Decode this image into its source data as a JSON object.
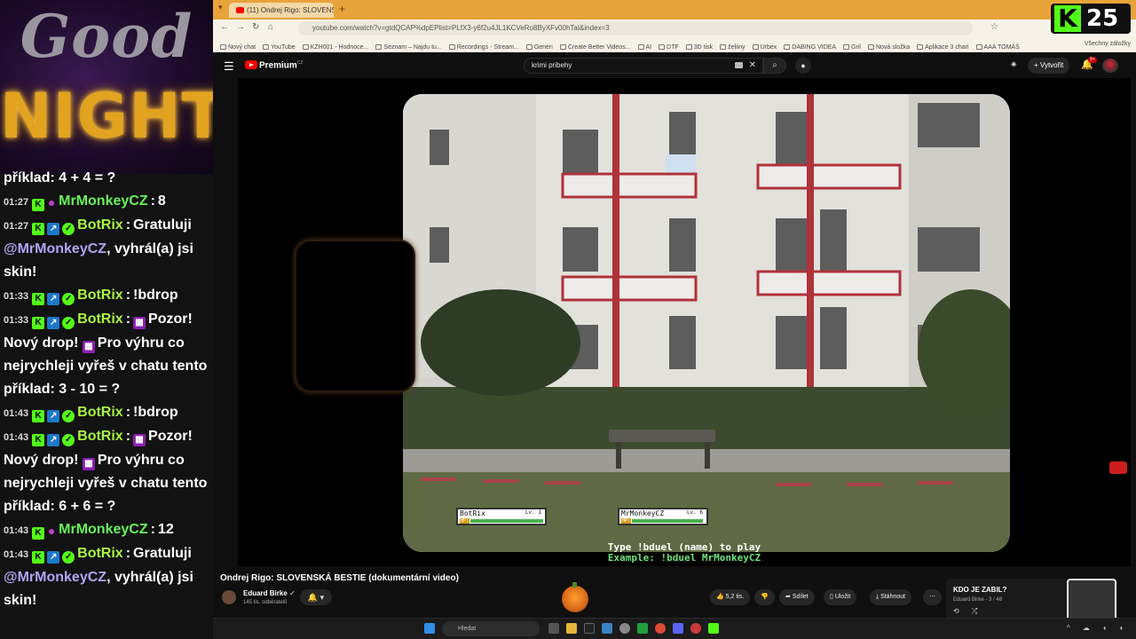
{
  "overlay": {
    "good": "Good",
    "night": "NIGHT"
  },
  "chat": {
    "msg0_text": "příklad: 4 + 4 = ?",
    "msg1_time": "01:27",
    "msg1_user": "MrMonkeyCZ",
    "msg1_text": "8",
    "msg2_time": "01:27",
    "msg2_user": "BotRix",
    "msg2_pre": "Gratuluji",
    "msg2_mention": "@MrMonkeyCZ",
    "msg2_post": ", vyhrál(a) jsi skin!",
    "msg3_time": "01:33",
    "msg3_user": "BotRix",
    "msg3_text": "!bdrop",
    "msg4_time": "01:33",
    "msg4_user": "BotRix",
    "msg4_a": "Pozor! Nový drop!",
    "msg4_b": "Pro výhru co nejrychleji vyřeš v chatu tento příklad: 3 - 10 = ?",
    "msg5_time": "01:43",
    "msg5_user": "BotRix",
    "msg5_text": "!bdrop",
    "msg6_time": "01:43",
    "msg6_user": "BotRix",
    "msg6_a": "Pozor! Nový drop!",
    "msg6_b": "Pro výhru co nejrychleji vyřeš v chatu tento příklad: 6 + 6 = ?",
    "msg7_time": "01:43",
    "msg7_user": "MrMonkeyCZ",
    "msg7_text": "12",
    "msg8_time": "01:43",
    "msg8_user": "BotRix",
    "msg8_pre": "Gratuluji",
    "msg8_mention": "@MrMonkeyCZ",
    "msg8_post": ", vyhrál(a) jsi skin!"
  },
  "kick": {
    "logo": "K",
    "viewers": "25"
  },
  "browser": {
    "tab_title": "(11) Ondrej Rigo: SLOVENSK",
    "url": "youtube.com/watch?v=gtdQCAP%dpEPlist=PLfX3-y6f2u4JL1KCVeRo8ByXFv00hTaI&index=3",
    "bookmarks": [
      "Nový chat",
      "YouTube",
      "KZH001 - Hodnoce...",
      "Seznam – Najdu tu...",
      "Recordings - Stream...",
      "Generi",
      "Create Better Videos...",
      "AI",
      "DTF",
      "3D tisk",
      "želiiny",
      "Urbex",
      "DABING VIDEA",
      "Gril",
      "Nová složka",
      "Aplikace 3 chari",
      "AAA TOMÁŠ"
    ],
    "all_bookmarks": "Všechny záložky"
  },
  "youtube": {
    "logo": "Premium",
    "logo_sup": "CZ",
    "search_value": "krimi pribehy",
    "create": "Vytvořit",
    "bell_badge": "9+",
    "video_title": "Ondrej Rigo: SLOVENSKÁ BESTIE (dokumentární video)",
    "channel": "Eduard Birke",
    "subscribers": "145 tis. odběratelů",
    "likes": "5,2 tis.",
    "share": "Sdílet",
    "save": "Uložit",
    "download": "Stáhnout",
    "playlist_title": "KDO JE ZABIL?",
    "playlist_sub": "Eduard Birke - 3 / 48"
  },
  "game": {
    "p1_name": "BotRix",
    "p1_level": "Lv. 1",
    "p1_hp": 1.0,
    "p2_name": "MrMonkeyCZ",
    "p2_level": "Lv. 6",
    "p2_hp": 0.97,
    "hp_label": "HP:",
    "cmd_line": "Type !bduel (name) to play",
    "cmd_example": "Example: !bduel MrMonkeyCZ"
  },
  "taskbar": {
    "search": "Hledat"
  }
}
